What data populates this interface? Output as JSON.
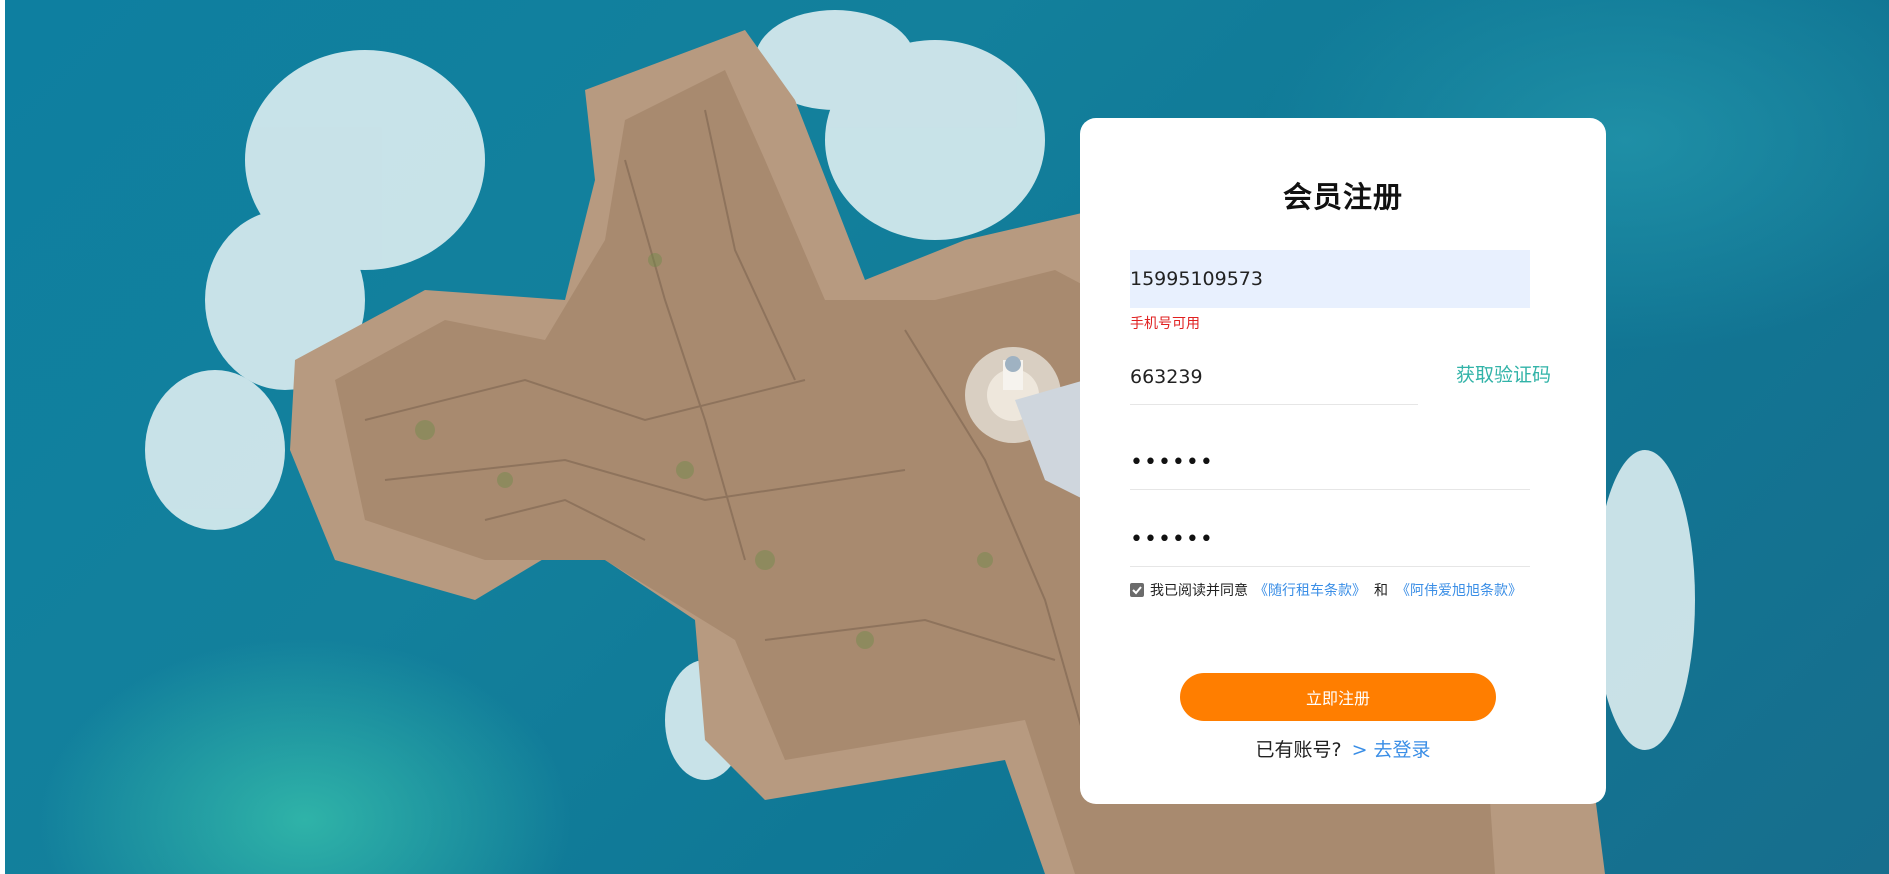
{
  "colors": {
    "accent_orange": "#ff7e00",
    "link_blue": "#3a8ee6",
    "teal": "#32b3a8",
    "error_red": "#e02020",
    "autofill_bg": "#e8f0fe"
  },
  "background": {
    "icon": "ocean-rock-photo"
  },
  "form": {
    "title": "会员注册",
    "phone_value": "15995109573",
    "phone_hint": "手机号可用",
    "code_value": "663239",
    "get_code_label": "获取验证码",
    "password_mask": "••••••",
    "confirm_password_mask": "••••••",
    "agreement": {
      "checked": true,
      "prefix": "我已阅读并同意",
      "link1": "《随行租车条款》",
      "conjunction": "和",
      "link2": "《阿伟爱旭旭条款》"
    },
    "submit_label": "立即注册",
    "have_account_text": "已有账号?",
    "login_link": "> 去登录"
  }
}
